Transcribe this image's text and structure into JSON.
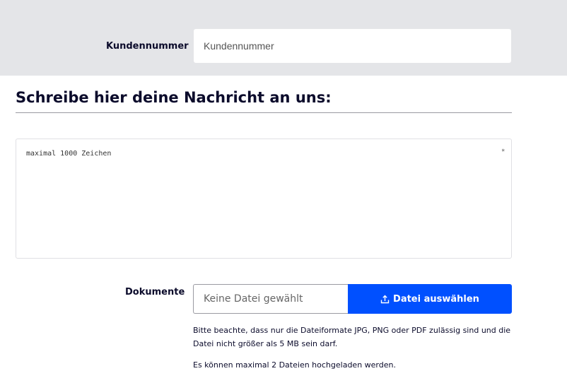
{
  "customer": {
    "label": "Kundennummer",
    "placeholder": "Kundennummer"
  },
  "message": {
    "heading": "Schreibe hier deine Nachricht an uns:",
    "placeholder": "maximal 1000 Zeichen",
    "required_marker": "*"
  },
  "documents": {
    "label": "Dokumente",
    "file_status": "Keine Datei gewählt",
    "button_label": "Datei auswählen",
    "button_icon": "upload-icon",
    "note_formats": "Bitte beachte, dass nur die Dateiformate JPG, PNG oder PDF zulässig sind und die Datei nicht größer als 5 MB sein darf.",
    "note_count": "Es können maximal 2 Dateien hochgeladen werden."
  },
  "colors": {
    "accent": "#0050ff",
    "band": "#e4e5e8"
  }
}
